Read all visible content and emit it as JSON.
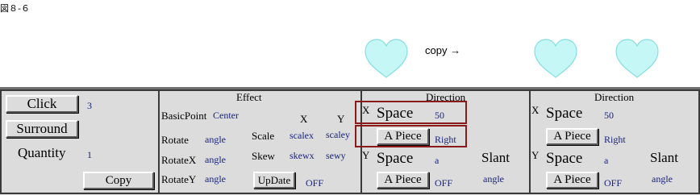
{
  "figure_caption": "図８-６",
  "copy_arrow": "copy →",
  "colors": {
    "heart_fill": "#c5f7f7",
    "heart_stroke": "#86dede",
    "panel_bg": "#dcdcdc",
    "highlight": "#8b1a1a",
    "value_text": "#1a237e"
  },
  "control": {
    "click_label": "Click",
    "click_value": "3",
    "surround_label": "Surround",
    "quantity_label": "Quantity",
    "quantity_value": "1",
    "copy_label": "Copy"
  },
  "effect": {
    "title": "Effect",
    "basicpoint_label": "BasicPoint",
    "basicpoint_value": "Center",
    "x_header": "X",
    "y_header": "Y",
    "rotate_label": "Rotate",
    "rotate_value": "angle",
    "rotatex_label": "RotateX",
    "rotatex_value": "angle",
    "rotatey_label": "RotateY",
    "rotatey_value": "angle",
    "scale_label": "Scale",
    "scalex_value": "scalex",
    "scaley_value": "scaley",
    "skew_label": "Skew",
    "skewx_value": "skewx",
    "skewy_value": "sewy",
    "update_label": "UpDate",
    "update_value": "OFF"
  },
  "direction1": {
    "title": "Direction",
    "x_label": "X",
    "space_x_label": "Space",
    "space_x_value": "50",
    "piece_x_label": "A Piece",
    "piece_x_value": "Right",
    "y_label": "Y",
    "space_y_label": "Space",
    "space_y_value": "a",
    "piece_y_label": "A Piece",
    "piece_y_value": "OFF",
    "slant_label": "Slant",
    "slant_value": "angle"
  },
  "direction2": {
    "title": "Direction",
    "x_label": "X",
    "space_x_label": "Space",
    "space_x_value": "50",
    "piece_x_label": "A Piece",
    "piece_x_value": "Right",
    "y_label": "Y",
    "space_y_label": "Space",
    "space_y_value": "a",
    "piece_y_label": "A Piece",
    "piece_y_value": "OFF",
    "slant_label": "Slant",
    "slant_value": "angle"
  }
}
